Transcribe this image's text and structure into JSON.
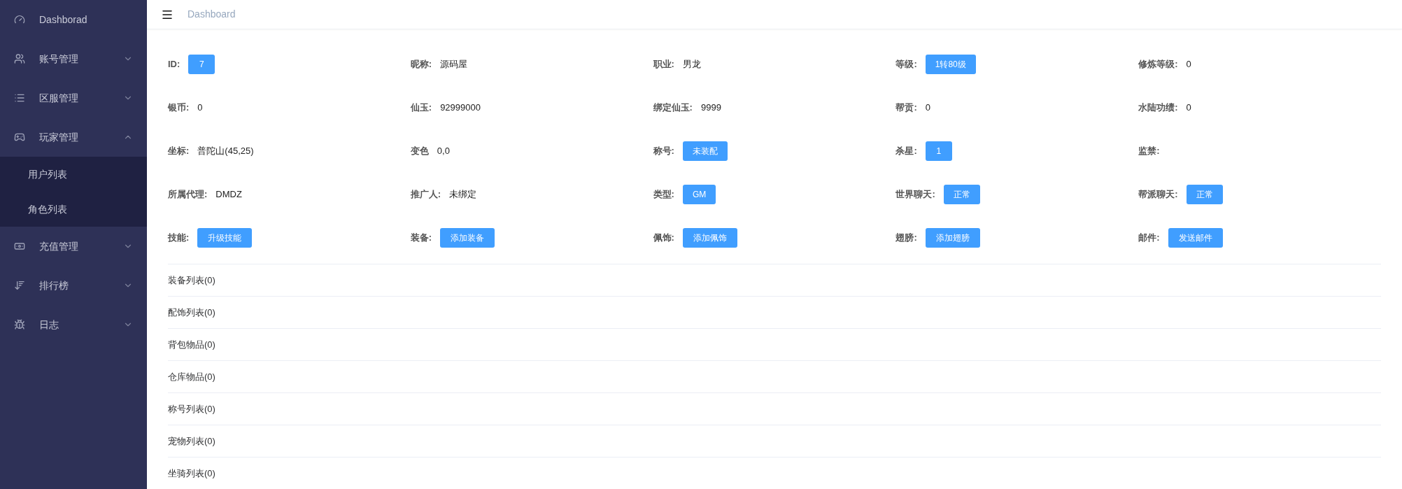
{
  "sidebar": {
    "items": [
      {
        "label": "Dashborad"
      },
      {
        "label": "账号管理",
        "expanded": false
      },
      {
        "label": "区服管理",
        "expanded": false
      },
      {
        "label": "玩家管理",
        "expanded": true,
        "children": [
          {
            "label": "用户列表"
          },
          {
            "label": "角色列表"
          }
        ]
      },
      {
        "label": "充值管理",
        "expanded": false
      },
      {
        "label": "排行榜",
        "expanded": false
      },
      {
        "label": "日志",
        "expanded": false
      }
    ]
  },
  "header": {
    "breadcrumb": "Dashboard"
  },
  "fields": [
    {
      "label": "ID:",
      "kind": "badge",
      "value": "7"
    },
    {
      "label": "昵称:",
      "kind": "text",
      "value": "源码屋"
    },
    {
      "label": "职业:",
      "kind": "text",
      "value": "男龙"
    },
    {
      "label": "等级:",
      "kind": "badge",
      "value": "1转80级"
    },
    {
      "label": "修炼等级:",
      "kind": "text",
      "value": "0"
    },
    {
      "label": "银币:",
      "kind": "text",
      "value": "0"
    },
    {
      "label": "仙玉:",
      "kind": "text",
      "value": "92999000"
    },
    {
      "label": "绑定仙玉:",
      "kind": "text",
      "value": "9999"
    },
    {
      "label": "帮贡:",
      "kind": "text",
      "value": "0"
    },
    {
      "label": "水陆功绩:",
      "kind": "text",
      "value": "0"
    },
    {
      "label": "坐标:",
      "kind": "text",
      "value": "普陀山(45,25)"
    },
    {
      "label": "变色",
      "kind": "text",
      "value": "0,0"
    },
    {
      "label": "称号:",
      "kind": "badge",
      "value": "未装配"
    },
    {
      "label": "杀星:",
      "kind": "badge",
      "value": "1"
    },
    {
      "label": "监禁:",
      "kind": "empty"
    },
    {
      "label": "所属代理:",
      "kind": "text",
      "value": "DMDZ"
    },
    {
      "label": "推广人:",
      "kind": "text",
      "value": "未绑定"
    },
    {
      "label": "类型:",
      "kind": "badge",
      "value": "GM"
    },
    {
      "label": "世界聊天:",
      "kind": "badge",
      "value": "正常"
    },
    {
      "label": "帮派聊天:",
      "kind": "badge",
      "value": "正常"
    },
    {
      "label": "技能:",
      "kind": "button",
      "value": "升级技能"
    },
    {
      "label": "装备:",
      "kind": "button",
      "value": "添加装备"
    },
    {
      "label": "佩饰:",
      "kind": "button",
      "value": "添加佩饰"
    },
    {
      "label": "翅膀:",
      "kind": "button",
      "value": "添加翅膀"
    },
    {
      "label": "邮件:",
      "kind": "button",
      "value": "发送邮件"
    }
  ],
  "sections": [
    "装备列表(0)",
    "配饰列表(0)",
    "背包物品(0)",
    "仓库物品(0)",
    "称号列表(0)",
    "宠物列表(0)",
    "坐骑列表(0)"
  ]
}
